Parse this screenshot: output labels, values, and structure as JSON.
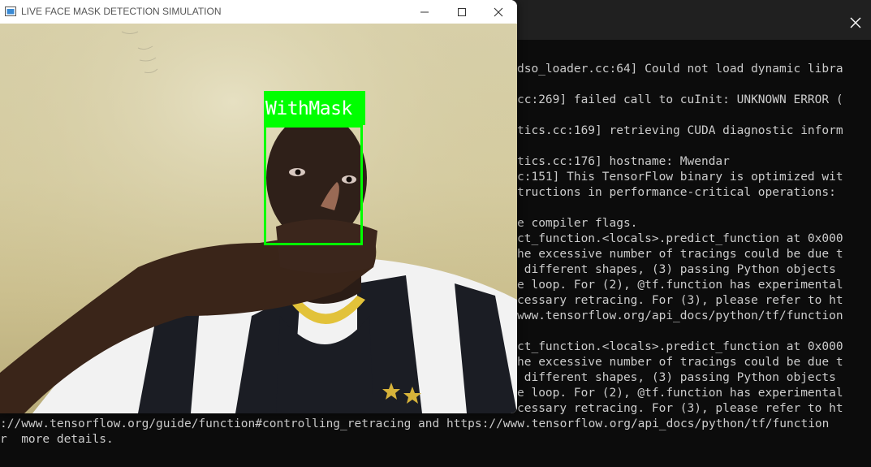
{
  "camera_window": {
    "title": "LIVE FACE MASK DETECTION SIMULATION",
    "controls": {
      "minimize": "minimize-icon",
      "maximize": "maximize-icon",
      "close": "close-icon"
    },
    "detection": {
      "label": "WithMask",
      "color": "#00ff00"
    }
  },
  "terminal": {
    "close_icon": "close-icon",
    "lines": [
      "dso_loader.cc:64] Could not load dynamic libra",
      "",
      "cc:269] failed call to cuInit: UNKNOWN ERROR (",
      "",
      "tics.cc:169] retrieving CUDA diagnostic inform",
      "",
      "tics.cc:176] hostname: Mwendar",
      "c:151] This TensorFlow binary is optimized wit",
      "tructions in performance-critical operations:",
      "",
      "e compiler flags.",
      "ct_function.<locals>.predict_function at 0x000",
      "he excessive number of tracings could be due t",
      " different shapes, (3) passing Python objects",
      "e loop. For (2), @tf.function has experimental",
      "cessary retracing. For (3), please refer to ht",
      "www.tensorflow.org/api_docs/python/tf/function",
      "",
      "ct_function.<locals>.predict_function at 0x000",
      "he excessive number of tracings could be due t",
      " different shapes, (3) passing Python objects",
      "e loop. For (2), @tf.function has experimental",
      "cessary retracing. For (3), please refer to ht"
    ],
    "full_lines": [
      "://www.tensorflow.org/guide/function#controlling_retracing and https://www.tensorflow.org/api_docs/python/tf/function",
      "r  more details."
    ]
  }
}
